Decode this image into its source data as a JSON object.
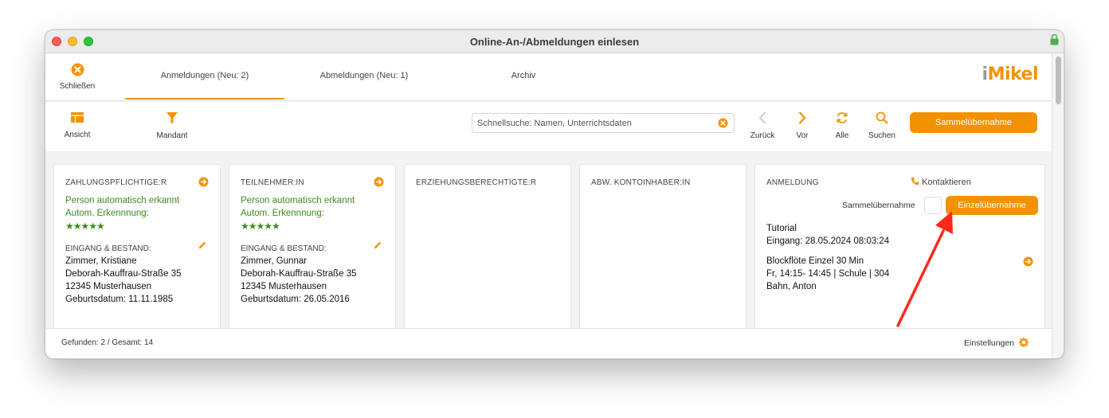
{
  "window": {
    "title": "Online-An-/Abmeldungen einlesen"
  },
  "tabbar": {
    "close_label": "Schließen",
    "tabs": [
      {
        "label": "Anmeldungen (Neu: 2)",
        "active": true
      },
      {
        "label": "Abmeldungen (Neu: 1)",
        "active": false
      },
      {
        "label": "Archiv",
        "active": false
      }
    ],
    "logo": {
      "i": "i",
      "rest": "Mikel"
    }
  },
  "toolbar": {
    "view_label": "Ansicht",
    "client_label": "Mandant",
    "search_placeholder": "Schnellsuche: Namen, Unterrichtsdaten",
    "back_label": "Zurück",
    "forward_label": "Vor",
    "all_label": "Alle",
    "search_label": "Suchen",
    "bulk_button": "Sammelübernahme"
  },
  "cards": {
    "payer": {
      "head": "ZAHLUNGSPFLICHTIGE:R",
      "auto": "Person automatisch erkannt",
      "recognition": "Autom. Erkennnung:",
      "stars": "★★★★★",
      "sub": "EINGANG & BESTAND:",
      "name": "Zimmer, Kristiane",
      "street": "Deborah-Kauffrau-Straße 35",
      "city": "12345 Musterhausen",
      "birth": "Geburtsdatum: 11.11.1985"
    },
    "participant": {
      "head": "TEILNEHMER:IN",
      "auto": "Person automatisch erkannt",
      "recognition": "Autom. Erkennnung:",
      "stars": "★★★★★",
      "sub": "EINGANG & BESTAND:",
      "name": "Zimmer, Gunnar",
      "street": "Deborah-Kauffrau-Straße 35",
      "city": "12345 Musterhausen",
      "birth": "Geburtsdatum: 26.05.2016"
    },
    "guardian": {
      "head": "ERZIEHUNGSBERECHTIGTE:R"
    },
    "account": {
      "head": "ABW. KONTOINHABER:IN"
    },
    "registration": {
      "head": "ANMELDUNG",
      "contact": "Kontaktieren",
      "bulk_label": "Sammelübernahme",
      "single_button": "Einzelübernahme",
      "type": "Tutorial",
      "received": "Eingang: 28.05.2024 08:03:24",
      "course": "Blockflöte Einzel 30 Min",
      "schedule": "Fr, 14:15- 14:45 | Schule | 304",
      "teacher": "Bahn, Anton"
    }
  },
  "footer": {
    "count": "Gefunden: 2 / Gesamt: 14",
    "settings": "Einstellungen"
  },
  "colors": {
    "accent": "#f39200",
    "green": "#3e8b1f",
    "annotation": "#ff2a1a"
  }
}
